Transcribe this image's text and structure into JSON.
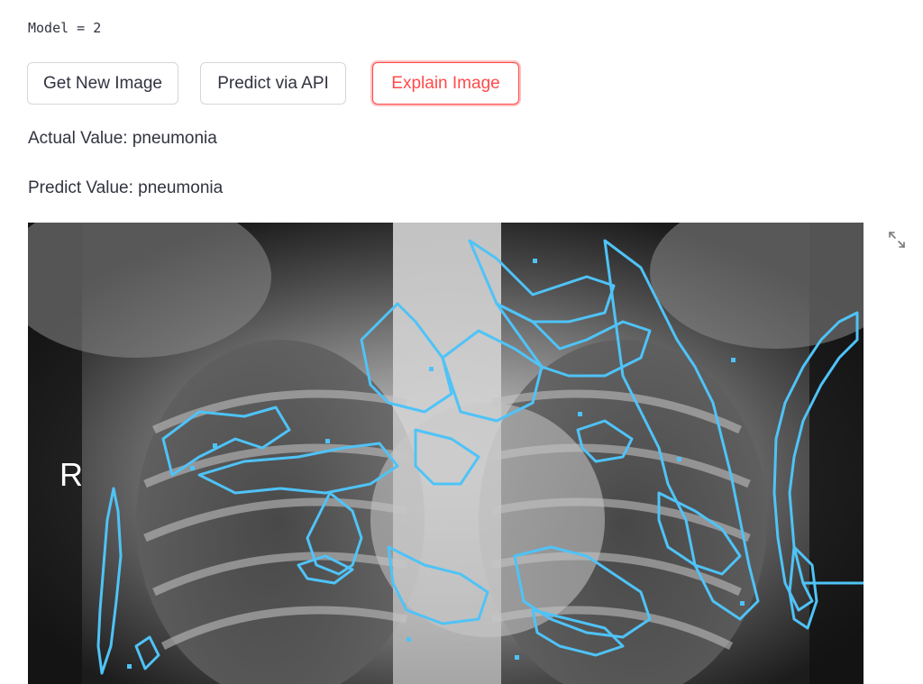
{
  "model_line": "Model = 2",
  "buttons": {
    "get_new_image": "Get New Image",
    "predict_api": "Predict via API",
    "explain_image": "Explain Image"
  },
  "actual_value": "Actual Value: pneumonia",
  "predict_value": "Predict Value: pneumonia",
  "xray": {
    "side_marker": "R",
    "overlay_color": "#4fc3f7"
  },
  "icons": {
    "fullscreen": "expand-arrows-icon"
  },
  "colors": {
    "accent": "#ff4b4b",
    "text": "#31333f",
    "border": "#d6d6d9"
  }
}
